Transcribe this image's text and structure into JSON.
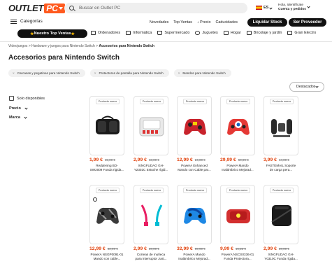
{
  "header": {
    "logo_text": "OUTLET",
    "logo_box": "PC",
    "search_placeholder": "Buscar en Outlet PC",
    "lang": "ES",
    "user_line1": "Hola, Identifícate",
    "user_line2": "Cuenta y pedidos"
  },
  "nav2": {
    "categories": "Categorías",
    "links": [
      "Novedades",
      "Top Ventas",
      "↓ Precio",
      "Caducidades"
    ],
    "liquidar": "Liquidar Stock",
    "proveedor": "Ser Proveedor"
  },
  "nav3": {
    "top_ventas": "Nuestro Top Ventas",
    "items": [
      "Ordenadores",
      "Informática",
      "Supermercado",
      "Juguetes",
      "Hogar",
      "Bricolaje y jardín",
      "Gran Electro"
    ]
  },
  "breadcrumb": {
    "items": [
      "Videojuegos",
      "Hardware y juegos para Nintendo Switch"
    ],
    "current": "Accesorios para Nintendo Switch"
  },
  "page_title": "Accesorios para Nintendo Switch",
  "chips": [
    "Carcasas y pegatinas para Nintendo Switch",
    "Protectores de pantalla para Nintendo Switch",
    "Mandos para Nintendo Switch"
  ],
  "sort": "Destacados",
  "filters": {
    "solo": "Solo disponibles",
    "precio": "Precio",
    "marca": "Marca"
  },
  "products": [
    {
      "badge": "Producto nuevo",
      "price": "1,99 €",
      "old": "15,00 €",
      "name1": "Reddening BD-",
      "name2": "SW2009 Funda rígida..."
    },
    {
      "badge": "Producto nuevo",
      "price": "2,99 €",
      "old": "13,00 €",
      "name1": "XINGFUDAO GH-",
      "name2": "Y2302C Estuche rígid..."
    },
    {
      "badge": "Producto nuevo",
      "price": "12,99 €",
      "old": "24,00 €",
      "name1": "PowerA Enhanced",
      "name2": "Mando con Cable par..."
    },
    {
      "badge": "Producto nuevo",
      "price": "29,99 €",
      "old": "59,99 €",
      "name1": "PowerA Mando",
      "name2": "Inalámbrico Mejorad..."
    },
    {
      "badge": "Producto nuevo",
      "price": "3,99 €",
      "old": "14,00 €",
      "name1": "FASTEMAIL Soporte",
      "name2": "de carga pera..."
    },
    {
      "badge": "Producto nuevo",
      "price": "12,99 €",
      "old": "32,90 €",
      "name1": "PowerA NSGP0091-01",
      "name2": "Mando con cable..."
    },
    {
      "badge": "Producto nuevo",
      "price": "2,99 €",
      "old": "20,00 €",
      "name1": "Correas de muñeca",
      "name2": "para interruptor Just..."
    },
    {
      "badge": "Producto nuevo",
      "price": "32,99 €",
      "old": "59,99 €",
      "name1": "PowerA Mando",
      "name2": "Inalámbrico Mejorad..."
    },
    {
      "badge": "Producto nuevo",
      "price": "9,99 €",
      "old": "16,22 €",
      "name1": "PowerA NSCS0336-01",
      "name2": "Funda Protectora..."
    },
    {
      "badge": "Producto nuevo",
      "price": "2,99 €",
      "old": "20,00 €",
      "name1": "XINGFUDAO GH-",
      "name2": "Y0310C Funda rígida..."
    }
  ],
  "colors": {
    "accent": "#ff5a1f",
    "price": "#e2440f",
    "dark": "#111111"
  }
}
